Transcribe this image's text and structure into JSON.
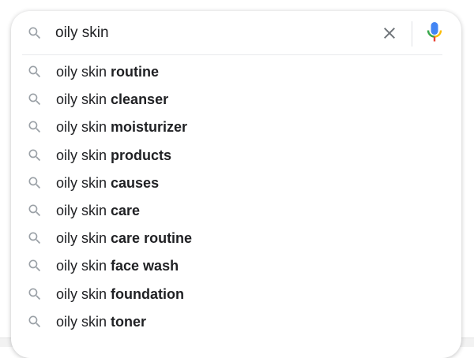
{
  "search": {
    "query": "oily skin",
    "icon": "search-icon",
    "clear_icon": "close-icon",
    "mic_icon": "microphone-icon"
  },
  "suggestions": [
    {
      "prefix": "oily skin ",
      "completion": "routine"
    },
    {
      "prefix": "oily skin ",
      "completion": "cleanser"
    },
    {
      "prefix": "oily skin ",
      "completion": "moisturizer"
    },
    {
      "prefix": "oily skin ",
      "completion": "products"
    },
    {
      "prefix": "oily skin ",
      "completion": "causes"
    },
    {
      "prefix": "oily skin ",
      "completion": "care"
    },
    {
      "prefix": "oily skin ",
      "completion": "care routine"
    },
    {
      "prefix": "oily skin ",
      "completion": "face wash"
    },
    {
      "prefix": "oily skin ",
      "completion": "foundation"
    },
    {
      "prefix": "oily skin ",
      "completion": "toner"
    }
  ],
  "colors": {
    "icon_gray": "#9aa0a6",
    "text": "#202124",
    "mic_blue": "#4285f4",
    "mic_red": "#ea4335",
    "mic_yellow": "#fbbc04",
    "mic_green": "#34a853"
  }
}
